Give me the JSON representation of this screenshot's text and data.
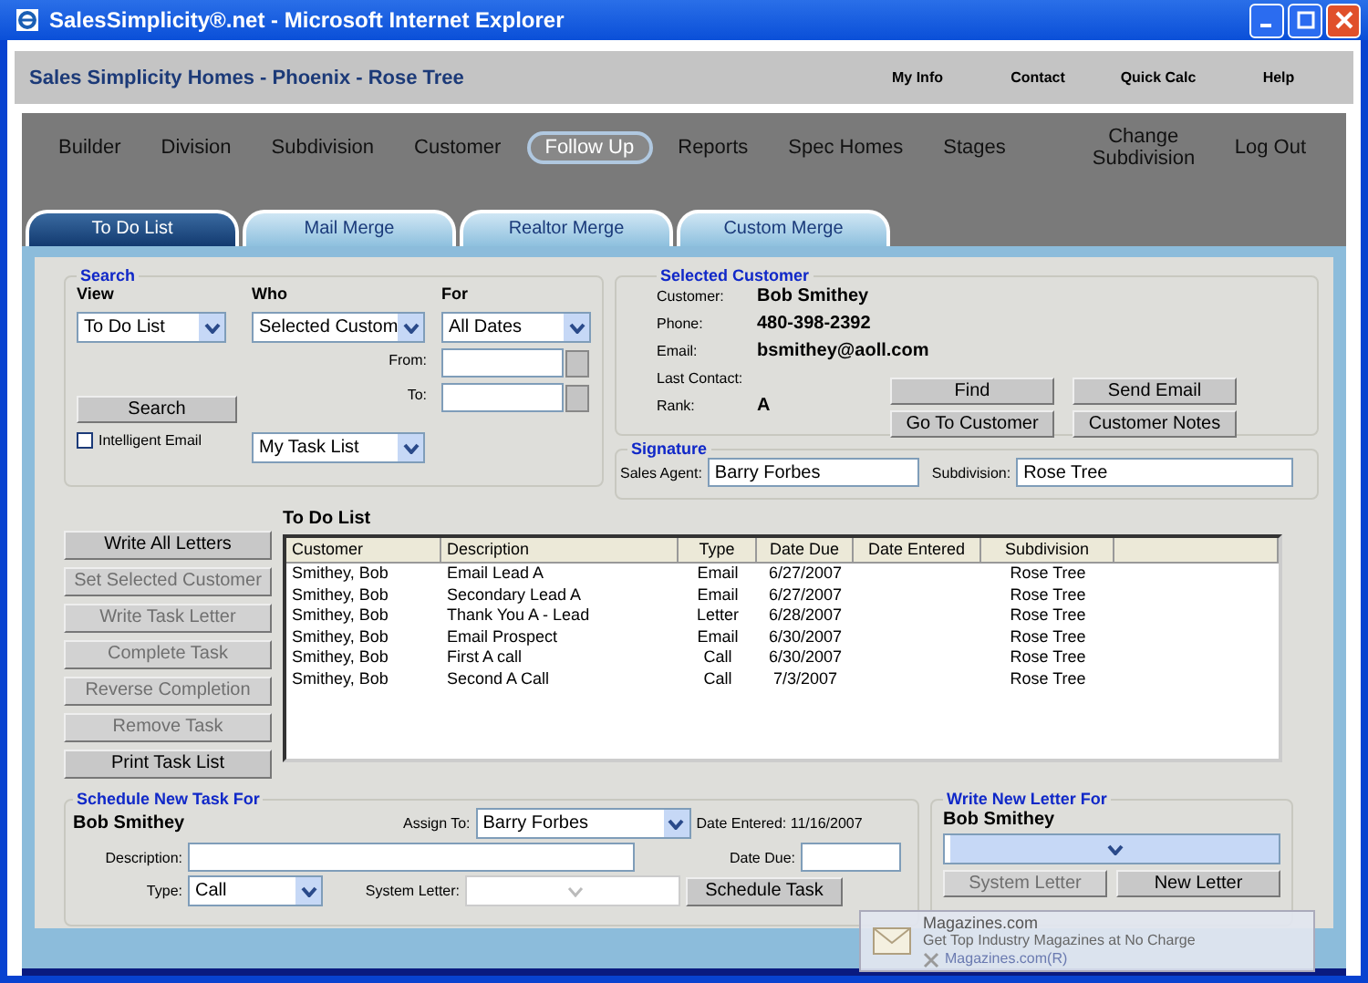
{
  "window": {
    "title": "SalesSimplicity®.net - Microsoft Internet Explorer"
  },
  "header": {
    "title": "Sales Simplicity Homes - Phoenix - Rose Tree",
    "links": [
      "My Info",
      "Contact",
      "Quick Calc",
      "Help"
    ]
  },
  "nav": {
    "items": [
      {
        "label": "Builder",
        "selected": false
      },
      {
        "label": "Division",
        "selected": false
      },
      {
        "label": "Subdivision",
        "selected": false
      },
      {
        "label": "Customer",
        "selected": false
      },
      {
        "label": "Follow Up",
        "selected": true
      },
      {
        "label": "Reports",
        "selected": false
      },
      {
        "label": "Spec Homes",
        "selected": false
      },
      {
        "label": "Stages",
        "selected": false
      }
    ],
    "change_subdivision": "Change Subdivision",
    "logout": "Log Out"
  },
  "tabs": [
    {
      "label": "To Do List",
      "selected": true
    },
    {
      "label": "Mail Merge",
      "selected": false
    },
    {
      "label": "Realtor Merge",
      "selected": false
    },
    {
      "label": "Custom Merge",
      "selected": false
    }
  ],
  "search": {
    "title": "Search",
    "view": {
      "label": "View",
      "value": "To Do List"
    },
    "who": {
      "label": "Who",
      "value": "Selected Custom"
    },
    "for": {
      "label": "For",
      "value": "All Dates"
    },
    "from_label": "From:",
    "to_label": "To:",
    "button": "Search",
    "intelligent_email": {
      "label": "Intelligent Email",
      "checked": false
    },
    "task_list": "My Task List"
  },
  "selected_customer": {
    "title": "Selected Customer",
    "fields": [
      {
        "label": "Customer:",
        "value": "Bob Smithey"
      },
      {
        "label": "Phone:",
        "value": "480-398-2392"
      },
      {
        "label": "Email:",
        "value": "bsmithey@aoll.com"
      },
      {
        "label": "Last Contact:"
      },
      {
        "label": "Rank:",
        "value": "A"
      }
    ],
    "buttons": [
      "Find",
      "Send Email",
      "Go To Customer",
      "Customer Notes"
    ]
  },
  "signature": {
    "title": "Signature",
    "sales_agent_label": "Sales Agent:",
    "sales_agent": "Barry Forbes",
    "subdivision_label": "Subdivision:",
    "subdivision": "Rose Tree"
  },
  "actions": [
    {
      "label": "Write All Letters",
      "disabled": false
    },
    {
      "label": "Set Selected Customer",
      "disabled": true
    },
    {
      "label": "Write Task Letter",
      "disabled": true
    },
    {
      "label": "Complete Task",
      "disabled": true
    },
    {
      "label": "Reverse Completion",
      "disabled": true
    },
    {
      "label": "Remove Task",
      "disabled": true
    },
    {
      "label": "Print Task List",
      "disabled": false
    }
  ],
  "todo": {
    "title": "To Do List",
    "columns": [
      "Customer",
      "Description",
      "Type",
      "Date Due",
      "Date Entered",
      "Subdivision"
    ],
    "rows": [
      {
        "customer": "Smithey, Bob",
        "description": "Email Lead A",
        "type": "Email",
        "date_due": "6/27/2007",
        "subdivision": "Rose Tree"
      },
      {
        "customer": "Smithey, Bob",
        "description": "Secondary Lead A",
        "type": "Email",
        "date_due": "6/27/2007",
        "subdivision": "Rose Tree"
      },
      {
        "customer": "Smithey, Bob",
        "description": "Thank You A - Lead",
        "type": "Letter",
        "date_due": "6/28/2007",
        "subdivision": "Rose Tree"
      },
      {
        "customer": "Smithey, Bob",
        "description": "Email Prospect",
        "type": "Email",
        "date_due": "6/30/2007",
        "subdivision": "Rose Tree"
      },
      {
        "customer": "Smithey, Bob",
        "description": "First A call",
        "type": "Call",
        "date_due": "6/30/2007",
        "subdivision": "Rose Tree"
      },
      {
        "customer": "Smithey, Bob",
        "description": "Second A Call",
        "type": "Call",
        "date_due": "7/3/2007",
        "subdivision": "Rose Tree"
      }
    ]
  },
  "schedule": {
    "title": "Schedule New Task For",
    "name": "Bob Smithey",
    "assign_label": "Assign To:",
    "assign_value": "Barry Forbes",
    "date_entered": "Date Entered: 11/16/2007",
    "description_label": "Description:",
    "date_due_label": "Date Due:",
    "type_label": "Type:",
    "type_value": "Call",
    "system_letter_label": "System Letter:",
    "button": "Schedule Task"
  },
  "letter": {
    "title": "Write New Letter For",
    "name": "Bob Smithey",
    "buttons": [
      {
        "label": "System Letter",
        "disabled": true
      },
      {
        "label": "New Letter",
        "disabled": false
      }
    ]
  },
  "ad_popup": {
    "title": "Magazines.com",
    "tagline": "Get Top Industry Magazines at No Charge",
    "footer": "Magazines.com(R)"
  }
}
